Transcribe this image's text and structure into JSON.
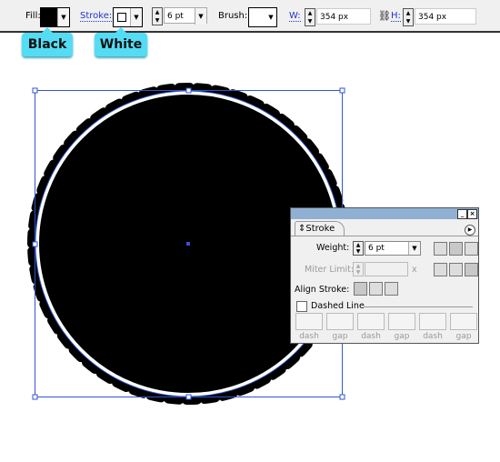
{
  "toolbar": {
    "fill_label": "Fill:",
    "stroke_label": "Stroke:",
    "weight_value": "6 pt",
    "brush_label": "Brush:",
    "w_label": "W:",
    "w_value": "354 px",
    "h_label": "H:",
    "h_value": "354 px",
    "link_icon": "chain-link-icon"
  },
  "callouts": {
    "fill": "Black",
    "stroke": "White"
  },
  "colors": {
    "fill": "#000000",
    "stroke": "#ffffff",
    "callout": "#55dcf5",
    "selection": "#3355cc"
  },
  "panel": {
    "tab": "Stroke",
    "weight_label": "Weight:",
    "weight_value": "6 pt",
    "miter_label": "Miter Limit:",
    "miter_unit": "x",
    "align_label": "Align Stroke:",
    "dashed_label": "Dashed Line",
    "dash_fields": [
      "dash",
      "gap",
      "dash",
      "gap",
      "dash",
      "gap"
    ]
  }
}
